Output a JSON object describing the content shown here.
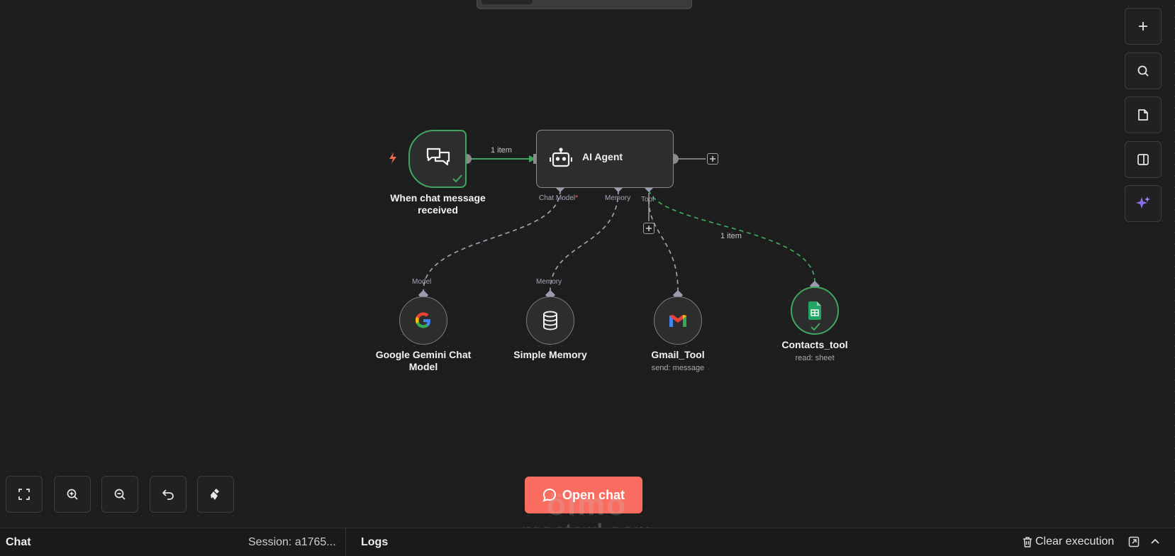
{
  "nodes": {
    "trigger": {
      "label": "When chat message received"
    },
    "agent": {
      "title": "AI Agent",
      "ports": {
        "chat_model": "Chat Model",
        "chat_model_required": "*",
        "memory": "Memory",
        "tool": "Tool"
      }
    },
    "gemini": {
      "label": "Google Gemini Chat Model",
      "port": "Model"
    },
    "memory": {
      "label": "Simple Memory",
      "port": "Memory"
    },
    "gmail": {
      "label": "Gmail_Tool",
      "sub": "send: message"
    },
    "contacts": {
      "label": "Contacts_tool",
      "sub": "read: sheet"
    }
  },
  "edges": {
    "trigger_to_agent": "1 item",
    "agent_to_contacts": "1 item"
  },
  "open_chat": {
    "label": "Open chat"
  },
  "bottom": {
    "chat": "Chat",
    "session": "Session: a1765...",
    "logs": "Logs",
    "clear": "Clear execution"
  },
  "watermark": {
    "logo": "ölmo",
    "text": "mostaql.com"
  },
  "colors": {
    "accent": "#f96d60",
    "success": "#3fa65f",
    "canvas": "#1d1d1d"
  },
  "icons": {
    "right_toolbar": [
      "plus-icon",
      "search-icon",
      "sticky-note-icon",
      "panel-icon",
      "sparkle-icon"
    ],
    "bottom_left": [
      "fit-view-icon",
      "zoom-in-icon",
      "zoom-out-icon",
      "undo-icon",
      "clear-icon"
    ]
  }
}
